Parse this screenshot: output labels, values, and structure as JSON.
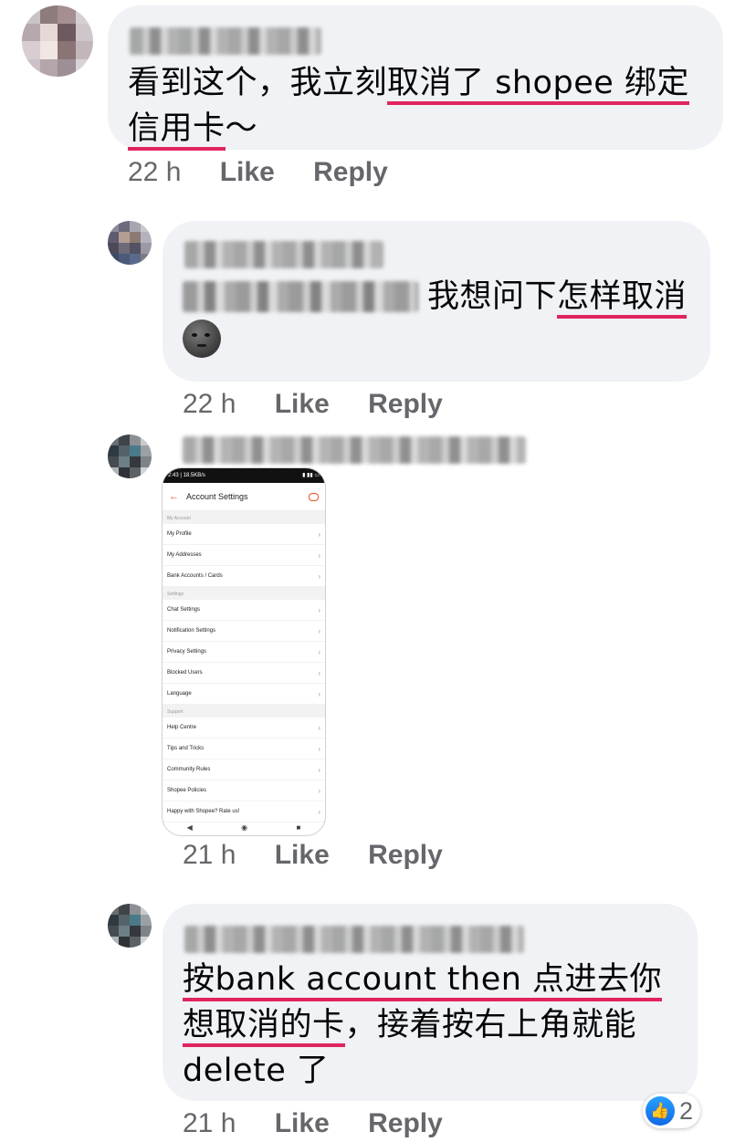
{
  "comments": [
    {
      "text_parts": [
        "看到这个，我立刻",
        "取消了 shopee 绑定信用卡",
        "～"
      ],
      "time": "22 h",
      "like_label": "Like",
      "reply_label": "Reply"
    },
    {
      "text_parts": [
        "我想问下",
        "怎样取消"
      ],
      "time": "22 h",
      "like_label": "Like",
      "reply_label": "Reply",
      "emoji": "new-moon-face"
    },
    {
      "time": "21 h",
      "like_label": "Like",
      "reply_label": "Reply",
      "attachment": {
        "status_left": "2:43 | 18.5KB/s",
        "title": "Account Settings",
        "sections": [
          {
            "label": "My Account",
            "items": [
              "My Profile",
              "My Addresses",
              "Bank Accounts / Cards"
            ]
          },
          {
            "label": "Settings",
            "items": [
              "Chat Settings",
              "Notification Settings",
              "Privacy Settings",
              "Blocked Users",
              "Language"
            ]
          },
          {
            "label": "Support",
            "items": [
              "Help Centre",
              "Tips and Tricks",
              "Community Rules",
              "Shopee Policies",
              "Happy with Shopee? Rate us!"
            ]
          }
        ]
      }
    },
    {
      "text_parts": [
        "按bank account then 点进去你想取消的卡",
        "，接着按右上角就能delete 了"
      ],
      "time": "21 h",
      "like_label": "Like",
      "reply_label": "Reply",
      "reaction_count": "2"
    }
  ],
  "colors": {
    "bubble": "#f0f2f5",
    "underline": "#e0245e",
    "meta": "#65676b",
    "like_blue": "#1877f2"
  }
}
